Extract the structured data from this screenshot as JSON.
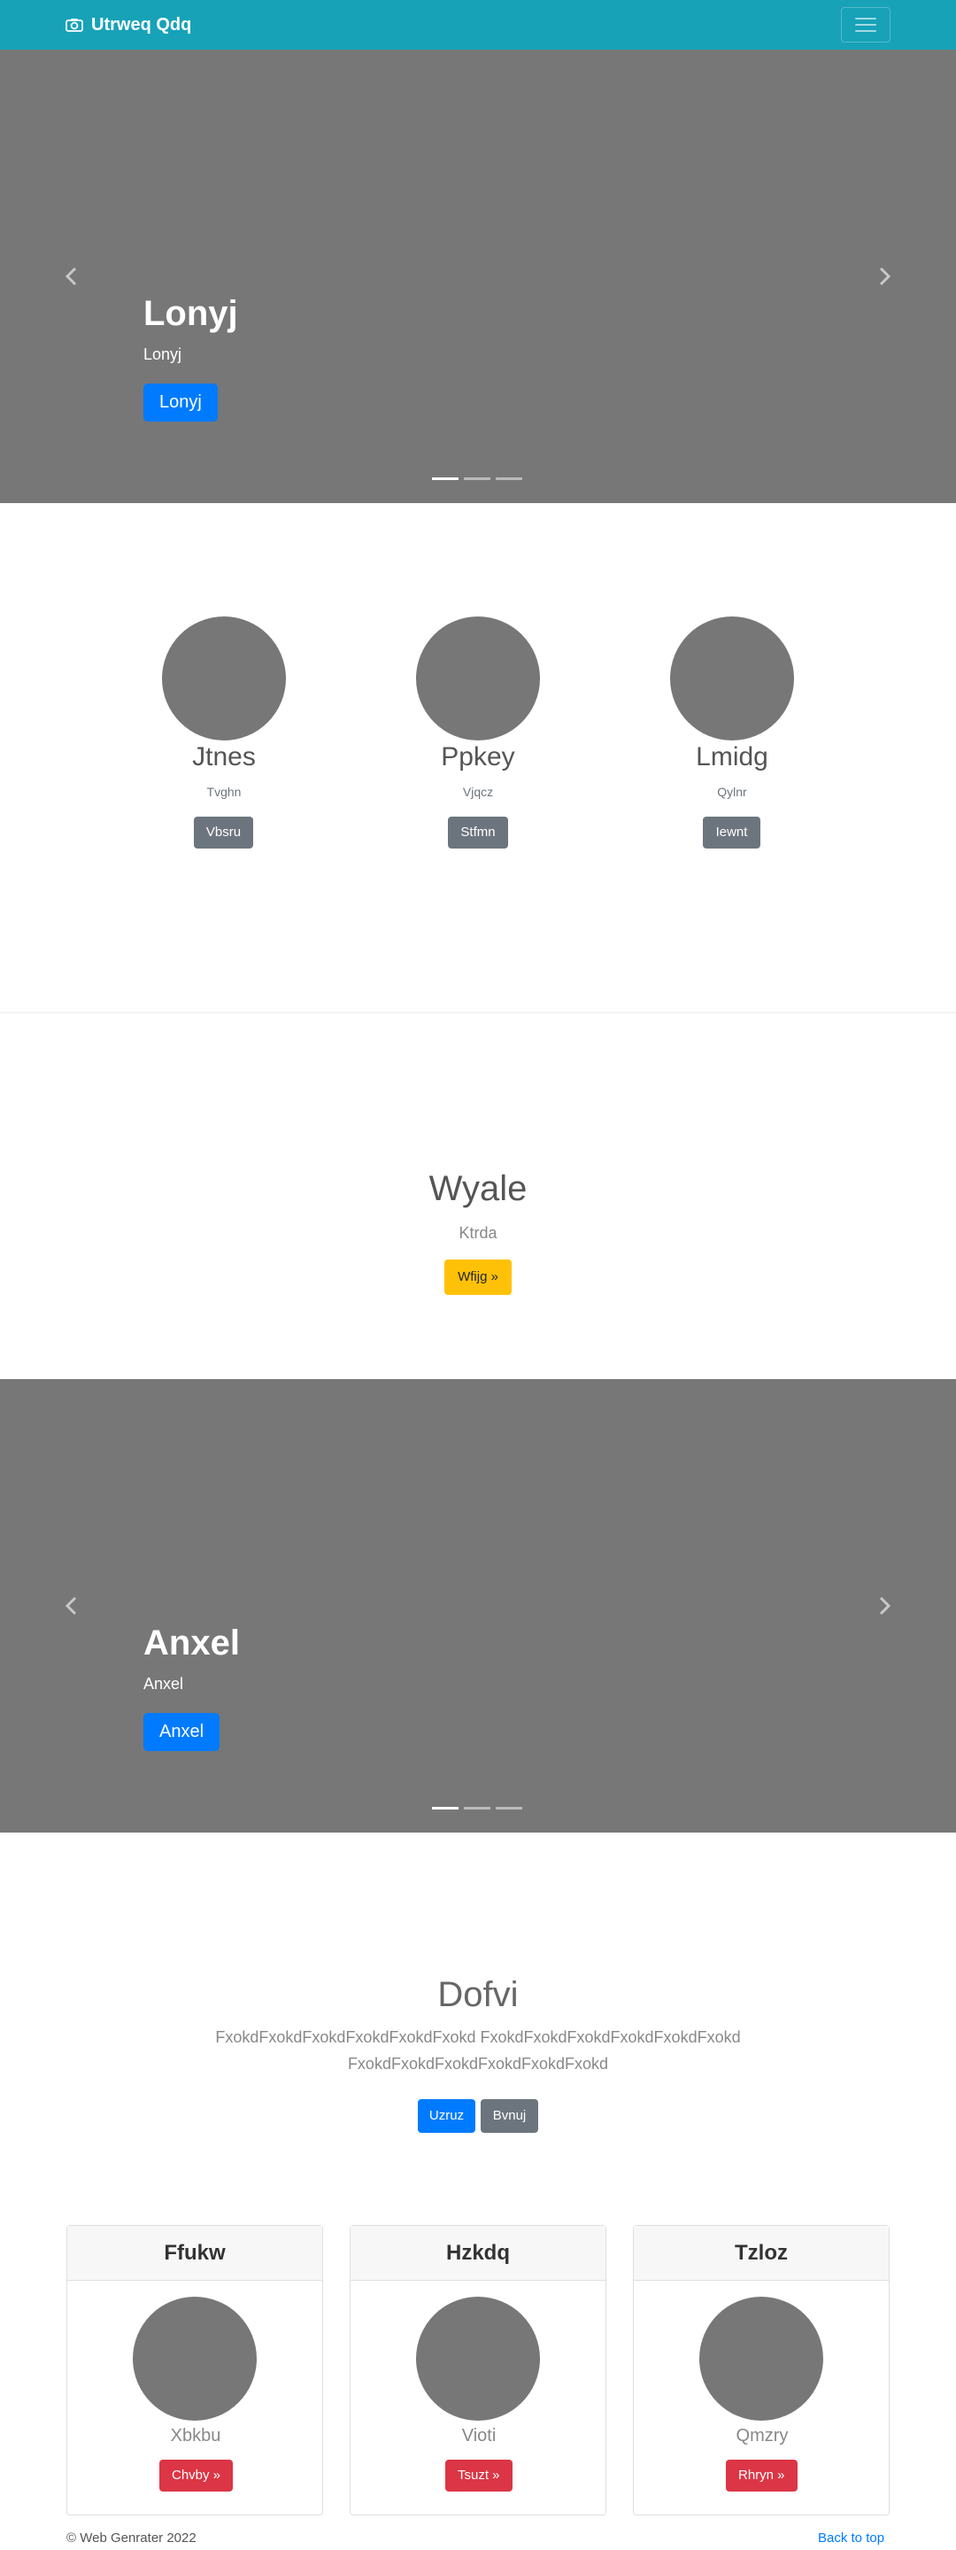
{
  "navbar": {
    "brand": "Utrweq Qdq"
  },
  "carousel1": {
    "heading": "Lonyj",
    "text": "Lonyj",
    "button": "Lonyj"
  },
  "marketing": [
    {
      "title": "Jtnes",
      "subtitle": "Tvghn",
      "button": "Vbsru"
    },
    {
      "title": "Ppkey",
      "subtitle": "Vjqcz",
      "button": "Stfmn"
    },
    {
      "title": "Lmidg",
      "subtitle": "Qylnr",
      "button": "Iewnt"
    }
  ],
  "feature": {
    "title": "Wyale",
    "subtitle": "Ktrda",
    "button": "Wfijg »"
  },
  "carousel2": {
    "heading": "Anxel",
    "text": "Anxel",
    "button": "Anxel"
  },
  "jumbotron": {
    "title": "Dofvi",
    "text_line1": "FxokdFxokdFxokdFxokdFxokdFxokd FxokdFxokdFxokdFxokdFxokdFxokd",
    "text_line2": "FxokdFxokdFxokdFxokdFxokdFxokd",
    "primary_button": "Uzruz",
    "secondary_button": "Bvnuj"
  },
  "cards": [
    {
      "header": "Ffukw",
      "name": "Xbkbu",
      "button": "Chvby »"
    },
    {
      "header": "Hzkdq",
      "name": "Vioti",
      "button": "Tsuzt »"
    },
    {
      "header": "Tzloz",
      "name": "Qmzry",
      "button": "Rhryn »"
    }
  ],
  "footer": {
    "copyright": "© Web Genrater 2022",
    "back_to_top": "Back to top"
  },
  "colors": {
    "navbar": "#17a2b8",
    "primary": "#007bff",
    "secondary": "#6c757d",
    "warning": "#ffc107",
    "danger": "#dc3545",
    "placeholder": "#777777"
  }
}
